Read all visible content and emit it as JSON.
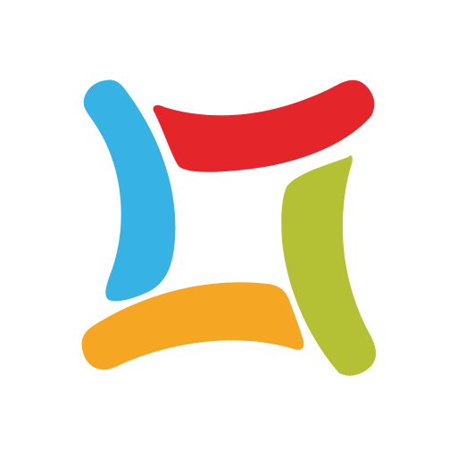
{
  "logo": {
    "icon": "four-color-square-logo-icon",
    "colors": {
      "background": "#ffffff",
      "blue": "#37b2e5",
      "red": "#e4262b",
      "green": "#b5c134",
      "orange": "#f5a623"
    }
  }
}
